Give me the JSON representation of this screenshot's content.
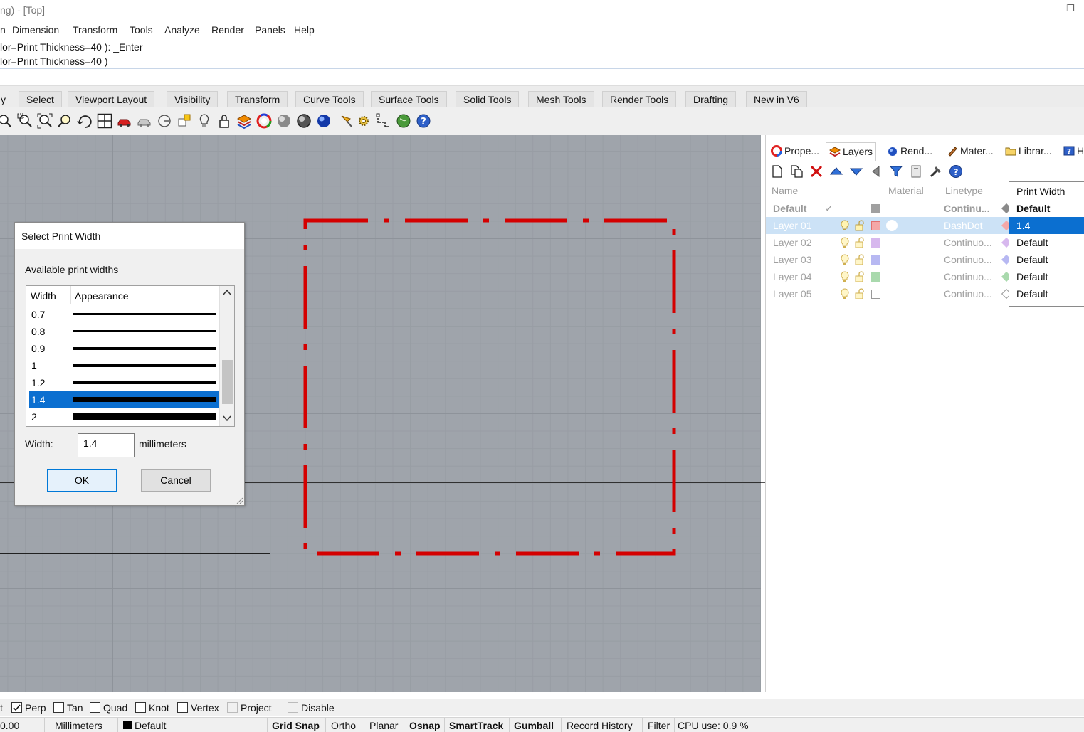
{
  "window": {
    "title": "ng) - [Top]",
    "minimize": "—",
    "restore": "❐"
  },
  "menu": [
    "n",
    "Dimension",
    "Transform",
    "Tools",
    "Analyze",
    "Render",
    "Panels",
    "Help"
  ],
  "command_history": [
    "lor=Print  Thickness=40 ): _Enter",
    "lor=Print  Thickness=40 )"
  ],
  "toolbar_tabs": [
    "y",
    "Select",
    "Viewport Layout",
    "Visibility",
    "Transform",
    "Curve Tools",
    "Surface Tools",
    "Solid Tools",
    "Mesh Tools",
    "Render Tools",
    "Drafting",
    "New in V6"
  ],
  "toolbar_icons": [
    "zoom-in-icon",
    "zoom-window-icon",
    "zoom-extents-icon",
    "zoom-selected-icon",
    "rotate-view-icon",
    "four-viewports-icon",
    "car-icon",
    "named-views-icon",
    "named-cplane-icon",
    "snapshot-icon",
    "light-icon",
    "lock-icon",
    "layer-icon",
    "color-wheel-icon",
    "shaded-sphere-icon",
    "rendered-sphere-icon",
    "render-sphere-icon",
    "pen-icon",
    "gear-options-icon",
    "grid-icon",
    "globe-icon",
    "help-icon"
  ],
  "dialog": {
    "title": "Select Print Width",
    "available_label": "Available print widths",
    "columns": [
      "Width",
      "Appearance"
    ],
    "widths": [
      {
        "value": "0.7",
        "thickness": 0.7
      },
      {
        "value": "0.8",
        "thickness": 0.8
      },
      {
        "value": "0.9",
        "thickness": 0.9
      },
      {
        "value": "1",
        "thickness": 1
      },
      {
        "value": "1.2",
        "thickness": 1.2
      },
      {
        "value": "1.4",
        "thickness": 1.4,
        "selected": true
      },
      {
        "value": "2",
        "thickness": 2
      }
    ],
    "width_label": "Width:",
    "width_value": "1.4",
    "unit": "millimeters",
    "ok": "OK",
    "cancel": "Cancel"
  },
  "panel": {
    "tabs": [
      {
        "label": "Prope...",
        "icon": "properties-icon"
      },
      {
        "label": "Layers",
        "icon": "layers-icon",
        "active": true
      },
      {
        "label": "Rend...",
        "icon": "rendering-icon"
      },
      {
        "label": "Mater...",
        "icon": "materials-icon"
      },
      {
        "label": "Librar...",
        "icon": "libraries-icon"
      },
      {
        "label": "H",
        "icon": "help-panel-icon"
      }
    ],
    "tool_icons": [
      "new-layer-icon",
      "new-sublayer-icon",
      "delete-icon",
      "move-up-icon",
      "move-down-icon",
      "move-left-icon",
      "filter-icon",
      "layer-state-icon",
      "tools-icon",
      "help-icon"
    ],
    "columns": {
      "name": "Name",
      "material": "Material",
      "linetype": "Linetype",
      "print_width": "Print Width"
    },
    "layers": [
      {
        "name": "Default",
        "linetype": "Continu...",
        "color": "#a0a0a0",
        "print_width": "Default",
        "current": true
      },
      {
        "name": "Layer 01",
        "linetype": "DashDot",
        "color": "#f4a7a7",
        "print_width": "1.4",
        "selected": true
      },
      {
        "name": "Layer 02",
        "linetype": "Continuo...",
        "color": "#d7b8ee",
        "print_width": "Default"
      },
      {
        "name": "Layer 03",
        "linetype": "Continuo...",
        "color": "#b7b8f2",
        "print_width": "Default"
      },
      {
        "name": "Layer 04",
        "linetype": "Continuo...",
        "color": "#a9d9ad",
        "print_width": "Default"
      },
      {
        "name": "Layer 05",
        "linetype": "Continuo...",
        "color": "#ffffff",
        "print_width": "Default"
      }
    ]
  },
  "osnap": [
    {
      "label": "t",
      "checkbox": false
    },
    {
      "label": "Perp",
      "checked": true
    },
    {
      "label": "Tan",
      "checked": false
    },
    {
      "label": "Quad",
      "checked": false
    },
    {
      "label": "Knot",
      "checked": false
    },
    {
      "label": "Vertex",
      "checked": false
    },
    {
      "label": "Project",
      "checked": false,
      "disabled": true
    },
    {
      "label": "Disable",
      "checked": false,
      "disabled": true
    }
  ],
  "status": {
    "coord": "0.00",
    "units": "Millimeters",
    "layer": "Default",
    "toggles": [
      "Grid Snap",
      "Ortho",
      "Planar",
      "Osnap",
      "SmartTrack",
      "Gumball",
      "Record History",
      "Filter"
    ],
    "cpu": "CPU use: 0.9 %"
  },
  "colors": {
    "accent": "#0b6fd0",
    "curve": "#d40000",
    "viewport": "#9fa4ab"
  }
}
